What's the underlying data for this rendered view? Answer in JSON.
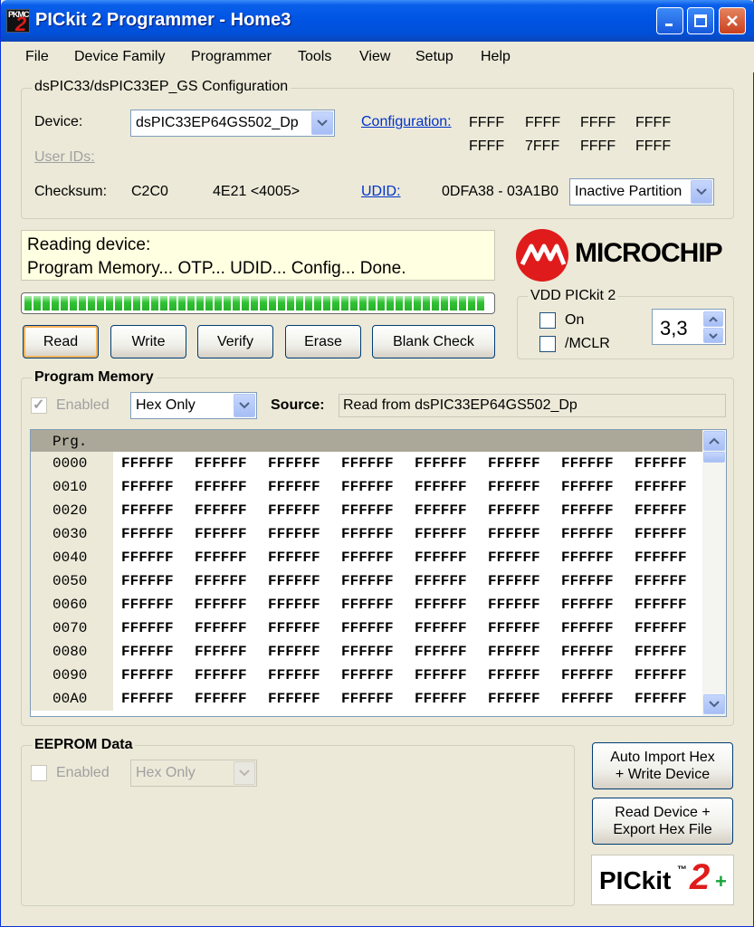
{
  "window": {
    "title": "PICkit 2 Programmer - Home3"
  },
  "app_icon": {
    "small": "PKMC",
    "big": "2"
  },
  "menu": [
    "File",
    "Device Family",
    "Programmer",
    "Tools",
    "View",
    "Setup",
    "Help"
  ],
  "config": {
    "group_title": "dsPIC33/dsPIC33EP_GS Configuration",
    "device_label": "Device:",
    "device_value": "dsPIC33EP64GS502_Dp",
    "user_ids_label": "User IDs:",
    "checksum_label": "Checksum:",
    "checksum_value": "C2C0",
    "checksum_alt": "4E21 <4005>",
    "configuration_link": "Configuration:",
    "config_row1": [
      "FFFF",
      "FFFF",
      "FFFF",
      "FFFF"
    ],
    "config_row2": [
      "FFFF",
      "7FFF",
      "FFFF",
      "FFFF"
    ],
    "udid_link": "UDID:",
    "udid_value": "0DFA38 - 03A1B0",
    "partition_value": "Inactive Partition"
  },
  "status": {
    "line1": "Reading device:",
    "line2": "Program Memory... OTP... UDID... Config... Done.",
    "progress": 1.0
  },
  "brand": {
    "logo": "MICROCHIP",
    "product": "PICkit",
    "tm": "™",
    "product_num": "2",
    "plus": "+"
  },
  "vdd": {
    "title": "VDD PICkit 2",
    "on_label": "On",
    "mclr_label": "/MCLR",
    "voltage": "3,3"
  },
  "actions": {
    "read": "Read",
    "write": "Write",
    "verify": "Verify",
    "erase": "Erase",
    "blank_check": "Blank Check"
  },
  "program_memory": {
    "title": "Program Memory",
    "enabled_label": "Enabled",
    "mode_value": "Hex Only",
    "source_label": "Source:",
    "source_value": "Read from dsPIC33EP64GS502_Dp",
    "header": "Prg.",
    "rows": [
      {
        "addr": "0000",
        "cells": [
          "FFFFFF",
          "FFFFFF",
          "FFFFFF",
          "FFFFFF",
          "FFFFFF",
          "FFFFFF",
          "FFFFFF",
          "FFFFFF"
        ]
      },
      {
        "addr": "0010",
        "cells": [
          "FFFFFF",
          "FFFFFF",
          "FFFFFF",
          "FFFFFF",
          "FFFFFF",
          "FFFFFF",
          "FFFFFF",
          "FFFFFF"
        ]
      },
      {
        "addr": "0020",
        "cells": [
          "FFFFFF",
          "FFFFFF",
          "FFFFFF",
          "FFFFFF",
          "FFFFFF",
          "FFFFFF",
          "FFFFFF",
          "FFFFFF"
        ]
      },
      {
        "addr": "0030",
        "cells": [
          "FFFFFF",
          "FFFFFF",
          "FFFFFF",
          "FFFFFF",
          "FFFFFF",
          "FFFFFF",
          "FFFFFF",
          "FFFFFF"
        ]
      },
      {
        "addr": "0040",
        "cells": [
          "FFFFFF",
          "FFFFFF",
          "FFFFFF",
          "FFFFFF",
          "FFFFFF",
          "FFFFFF",
          "FFFFFF",
          "FFFFFF"
        ]
      },
      {
        "addr": "0050",
        "cells": [
          "FFFFFF",
          "FFFFFF",
          "FFFFFF",
          "FFFFFF",
          "FFFFFF",
          "FFFFFF",
          "FFFFFF",
          "FFFFFF"
        ]
      },
      {
        "addr": "0060",
        "cells": [
          "FFFFFF",
          "FFFFFF",
          "FFFFFF",
          "FFFFFF",
          "FFFFFF",
          "FFFFFF",
          "FFFFFF",
          "FFFFFF"
        ]
      },
      {
        "addr": "0070",
        "cells": [
          "FFFFFF",
          "FFFFFF",
          "FFFFFF",
          "FFFFFF",
          "FFFFFF",
          "FFFFFF",
          "FFFFFF",
          "FFFFFF"
        ]
      },
      {
        "addr": "0080",
        "cells": [
          "FFFFFF",
          "FFFFFF",
          "FFFFFF",
          "FFFFFF",
          "FFFFFF",
          "FFFFFF",
          "FFFFFF",
          "FFFFFF"
        ]
      },
      {
        "addr": "0090",
        "cells": [
          "FFFFFF",
          "FFFFFF",
          "FFFFFF",
          "FFFFFF",
          "FFFFFF",
          "FFFFFF",
          "FFFFFF",
          "FFFFFF"
        ]
      },
      {
        "addr": "00A0",
        "cells": [
          "FFFFFF",
          "FFFFFF",
          "FFFFFF",
          "FFFFFF",
          "FFFFFF",
          "FFFFFF",
          "FFFFFF",
          "FFFFFF"
        ]
      }
    ]
  },
  "eeprom": {
    "title": "EEPROM Data",
    "enabled_label": "Enabled",
    "mode_value": "Hex Only"
  },
  "side_buttons": {
    "auto_import_1": "Auto Import Hex",
    "auto_import_2": "+ Write Device",
    "read_export_1": "Read Device +",
    "read_export_2": "Export Hex File"
  },
  "colors": {
    "title_bar": "#0054E3",
    "link": "#0033CC",
    "status_bg": "#FFFFE1",
    "progress": "#2FC232",
    "microchip_red": "#E01B1B"
  }
}
